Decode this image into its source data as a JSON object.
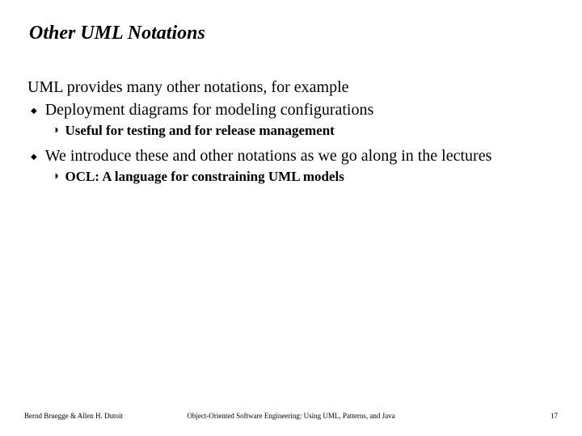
{
  "title": "Other UML Notations",
  "intro": "UML provides many other notations, for example",
  "bullets": [
    {
      "text": "Deployment diagrams for modeling configurations",
      "sub": "Useful for testing and for release management"
    },
    {
      "text": "We introduce these and other notations as we go along in the lectures",
      "sub": "OCL: A language for constraining UML models"
    }
  ],
  "footer": {
    "left": "Bernd Bruegge & Allen H. Dutoit",
    "center": "Object-Oriented Software Engineering: Using UML, Patterns, and Java",
    "right": "17"
  }
}
